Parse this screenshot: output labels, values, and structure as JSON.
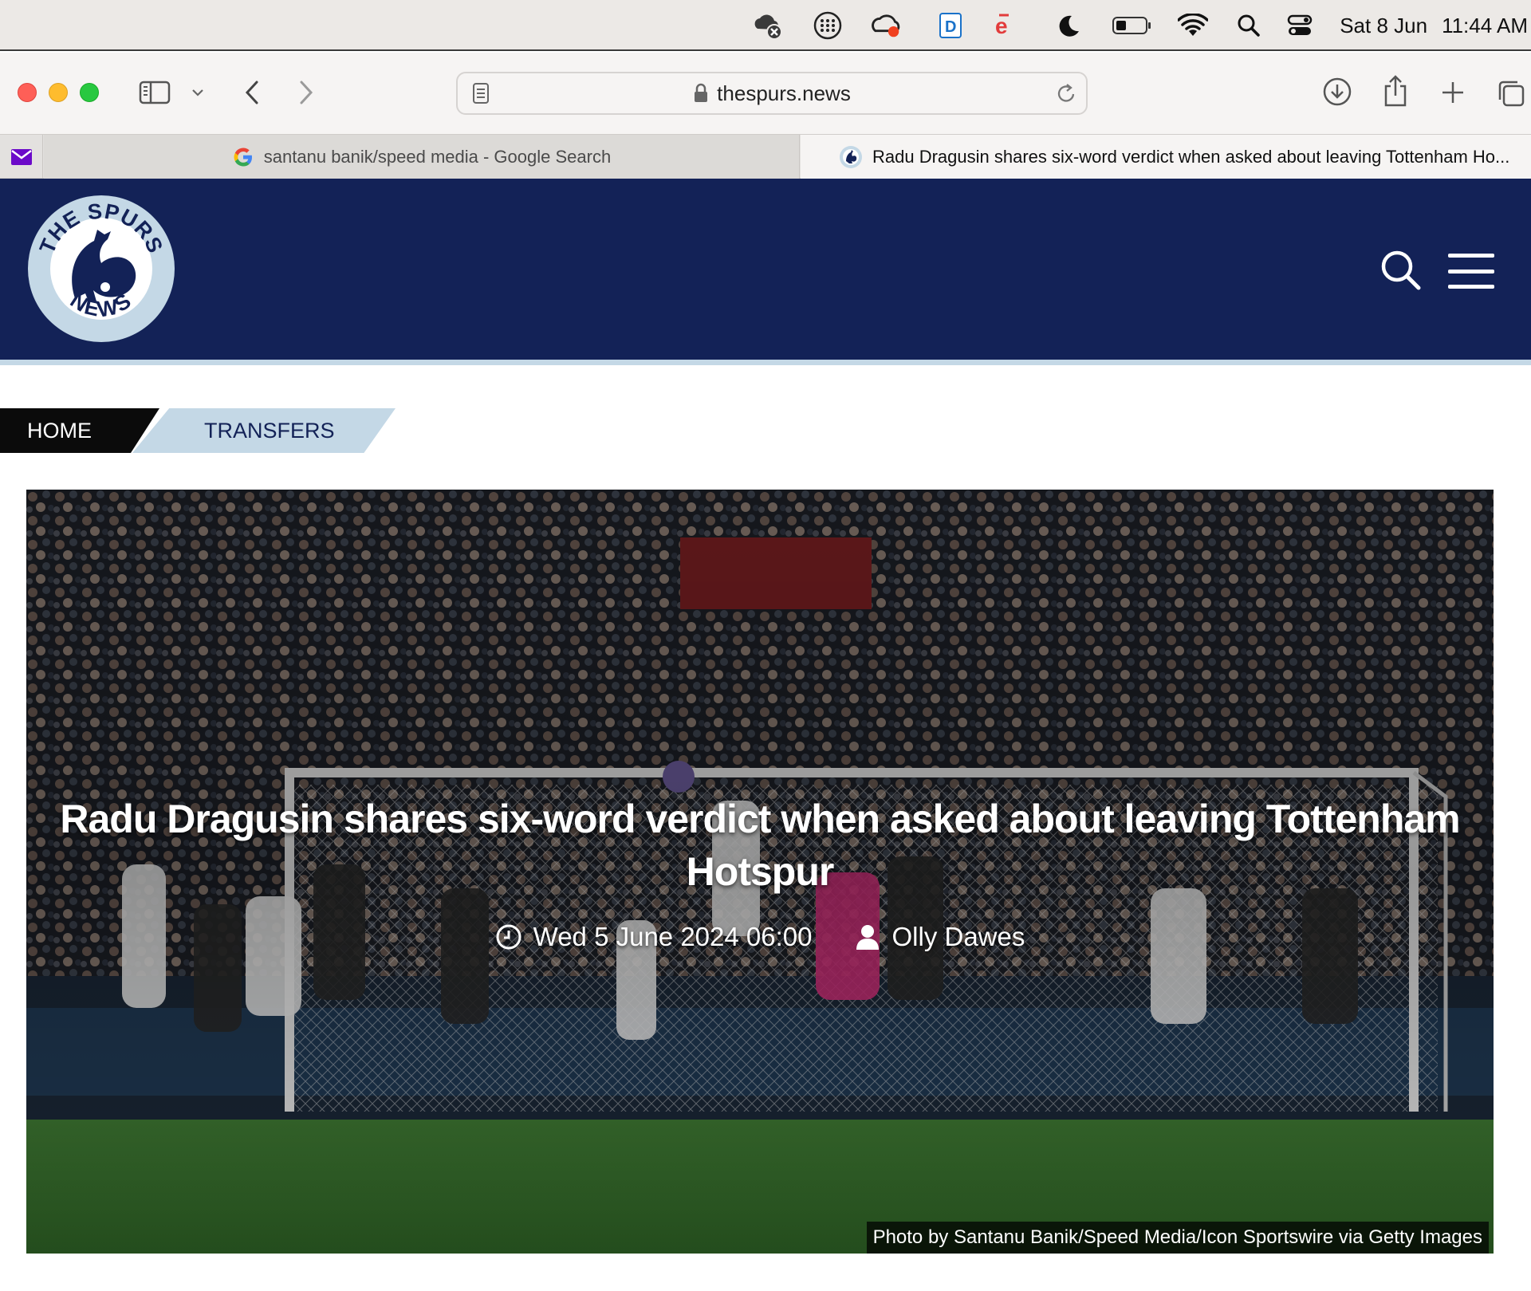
{
  "menubar": {
    "icons": [
      "cloud-error-icon",
      "grid-dots-icon",
      "creative-cloud-icon",
      "dictionary-app-icon",
      "e-app-icon",
      "moon-icon",
      "battery-icon",
      "wifi-icon",
      "spotlight-search-icon",
      "control-center-icon"
    ],
    "date": "Sat 8 Jun",
    "time": "11:44 AM"
  },
  "browser": {
    "url": "thespurs.news",
    "tabs": [
      {
        "label": "santanu banik/speed media - Google Search",
        "icon": "google-icon",
        "active": false
      },
      {
        "label": "Radu Dragusin shares six-word verdict when asked about leaving Tottenham Ho...",
        "icon": "spurs-favicon-icon",
        "active": true
      }
    ],
    "pinned_tab_icon": "mail-icon"
  },
  "site": {
    "logo_top": "THE SPURS",
    "logo_bottom": "NEWS",
    "header_color": "#132257",
    "accent_color": "#c4d8e6"
  },
  "breadcrumb": {
    "home": "HOME",
    "section": "TRANSFERS"
  },
  "article": {
    "title": "Radu Dragusin shares six-word verdict when asked about leaving Tottenham Hotspur",
    "date": "Wed 5 June 2024 06:00",
    "author": "Olly Dawes",
    "photo_credit": "Photo by Santanu Banik/Speed Media/Icon Sportswire via Getty Images"
  }
}
